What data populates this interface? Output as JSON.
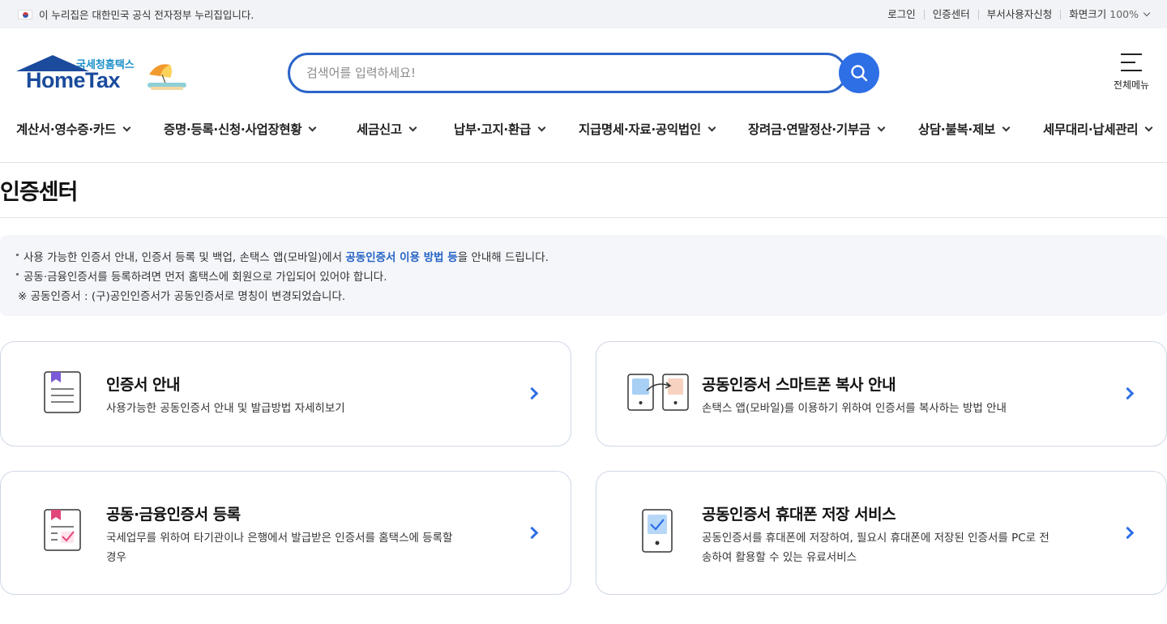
{
  "gov_banner": {
    "text": "이 누리집은 대한민국 공식 전자정부 누리집입니다.",
    "links": [
      "로그인",
      "인증센터",
      "부서사용자신청"
    ],
    "zoom_label": "화면크기",
    "zoom_value": "100%"
  },
  "logo": {
    "sub": "국세청홈택스",
    "main": "HomeTax"
  },
  "search": {
    "placeholder": "검색어를 입력하세요!"
  },
  "menu_all": {
    "label": "전체메뉴"
  },
  "gnb": [
    "계산서·영수증·카드",
    "증명·등록·신청·사업장현황",
    "세금신고",
    "납부·고지·환급",
    "지급명세·자료·공익법인",
    "장려금·연말정산·기부금",
    "상담·불복·제보",
    "세무대리·납세관리"
  ],
  "page": {
    "title": "인증센터"
  },
  "notice": {
    "line1_pre": "사용 가능한 인증서 안내, 인증서 등록 및 백업, 손택스 앱(모바일)에서 ",
    "line1_hl": "공동인증서 이용 방법 등",
    "line1_post": "을 안내해 드립니다.",
    "line2": "공동·금융인증서를 등록하려면 먼저 홈택스에 회원으로 가입되어 있어야 합니다.",
    "line3": "※ 공동인증서 : (구)공인인증서가 공동인증서로 명칭이 변경되었습니다."
  },
  "cards": [
    {
      "title": "인증서 안내",
      "desc": "사용가능한 공동인증서 안내 및 발급방법 자세히보기"
    },
    {
      "title": "공동인증서 스마트폰 복사 안내",
      "desc": "손택스 앱(모바일)를 이용하기 위하여 인증서를 복사하는 방법 안내"
    },
    {
      "title": "공동·금융인증서 등록",
      "desc": "국세업무를 위하여 타기관이나 은행에서 발급받은 인증서를 홈택스에 등록할 경우"
    },
    {
      "title": "공동인증서 휴대폰 저장 서비스",
      "desc": "공동인증서를 휴대폰에 저장하여, 필요시 휴대폰에 저장된 인증서를 PC로 전송하여 활용할 수 있는 유료서비스"
    }
  ],
  "colors": {
    "primary": "#2f6fe6",
    "brand": "#1a4b9c",
    "highlight": "#2663c4",
    "card_border": "#cfd7e6"
  }
}
